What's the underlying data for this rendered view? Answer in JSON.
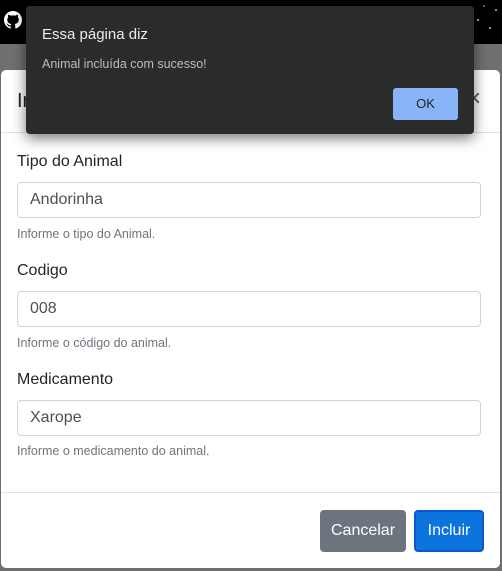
{
  "alert": {
    "title": "Essa página diz",
    "message": "Animal incluída com sucesso!",
    "ok_label": "OK"
  },
  "modal": {
    "title_partial": "In",
    "close_glyph": "×",
    "fields": [
      {
        "label": "Tipo do Animal",
        "value": "Andorinha",
        "help": "Informe o tipo do Animal."
      },
      {
        "label": "Codigo",
        "value": "008",
        "help": "Informe o código do animal."
      },
      {
        "label": "Medicamento",
        "value": "Xarope",
        "help": "Informe o medicamento do animal."
      }
    ],
    "cancel_label": "Cancelar",
    "submit_label": "Incluir"
  },
  "icons": {
    "github": "github-icon"
  },
  "colors": {
    "primary": "#0b74dd",
    "secondary": "#6c757d",
    "alert_bg": "#2b2b2b",
    "alert_button": "#8ab4f8"
  }
}
